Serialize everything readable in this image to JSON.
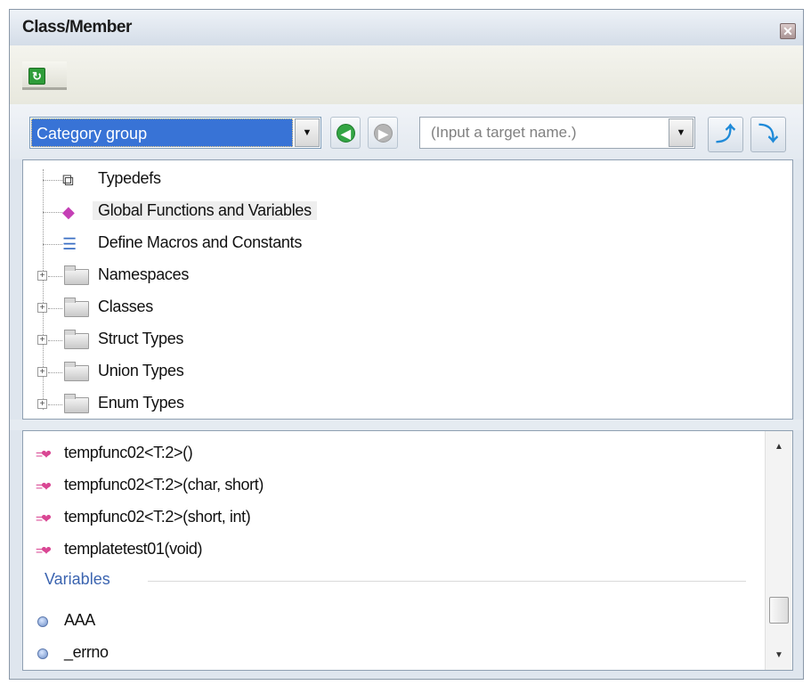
{
  "window": {
    "title": "Class/Member",
    "close_glyph": "✕"
  },
  "toolbar": {
    "refresh_icon": "refresh-icon",
    "refresh_glyph": "↻",
    "category_combo": {
      "value": "Category group"
    },
    "back_glyph": "◀",
    "forward_glyph": "▶",
    "target_input": {
      "placeholder": "(Input a target name.)",
      "value": ""
    },
    "jump_up_glyph": "⤴",
    "jump_down_glyph": "⤵",
    "dropdown_glyph": "▼"
  },
  "tree": {
    "items": [
      {
        "label": "Typedefs",
        "icon": "typedef-icon",
        "glyph": "⧉"
      },
      {
        "label": "Global Functions and Variables",
        "icon": "global-functions-icon",
        "glyph": "◆",
        "selected": true
      },
      {
        "label": "Define Macros and Constants",
        "icon": "define-macros-icon",
        "glyph": "☰"
      },
      {
        "label": "Namespaces",
        "icon": "folder-icon",
        "expand": "+"
      },
      {
        "label": "Classes",
        "icon": "folder-icon",
        "expand": "+"
      },
      {
        "label": "Struct Types",
        "icon": "folder-icon",
        "expand": "+"
      },
      {
        "label": "Union Types",
        "icon": "folder-icon",
        "expand": "+"
      },
      {
        "label": "Enum Types",
        "icon": "folder-icon",
        "expand": "+"
      }
    ]
  },
  "members": {
    "functions": [
      {
        "label": "tempfunc02<T:2>()",
        "icon_glyph": "=❤"
      },
      {
        "label": "tempfunc02<T:2>(char, short)",
        "icon_glyph": "=❤"
      },
      {
        "label": "tempfunc02<T:2>(short, int)",
        "icon_glyph": "=❤"
      },
      {
        "label": "templatetest01(void)",
        "icon_glyph": "=❤"
      }
    ],
    "variables_header": "Variables",
    "variables": [
      {
        "label": "AAA"
      },
      {
        "label": "_errno"
      }
    ],
    "scroll_up_glyph": "▲",
    "scroll_down_glyph": "▼"
  }
}
